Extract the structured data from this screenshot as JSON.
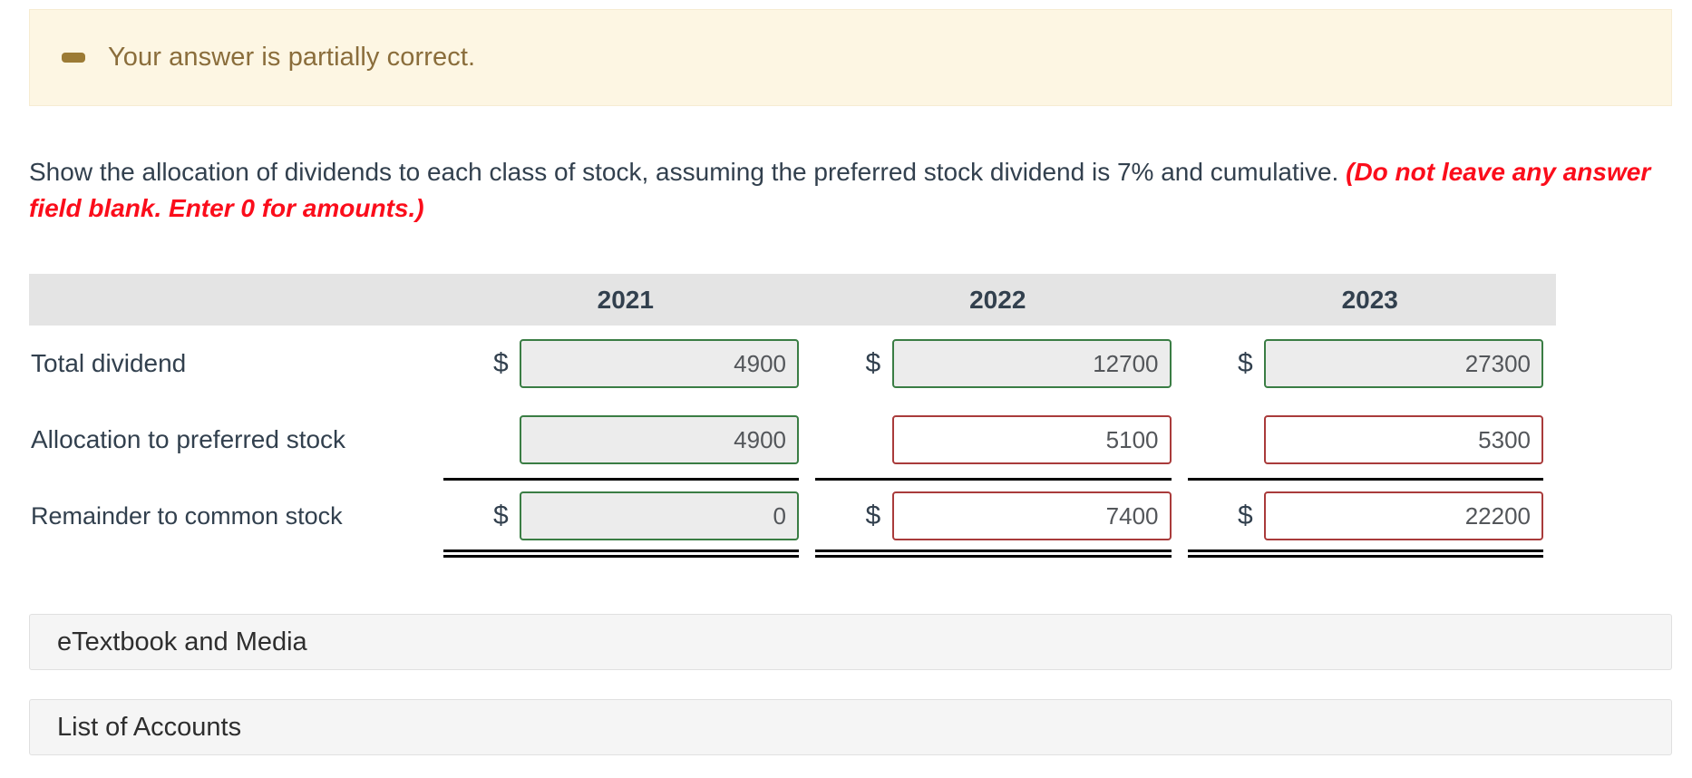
{
  "alert": {
    "icon": "minus-dash-icon",
    "message": "Your answer is partially correct.",
    "bg_color": "#fdf6e3",
    "text_color": "#8a6d3b"
  },
  "prompt": {
    "text_part1": "Show the allocation of dividends to each class of stock, assuming the preferred stock dividend is 7% and cumulative. ",
    "text_warning": "(Do not leave any answer field blank. Enter 0 for amounts.)",
    "warning_color": "#fb0d1b"
  },
  "table": {
    "columns": [
      "",
      "2021",
      "2022",
      "2023"
    ],
    "rows": [
      {
        "label": "Total dividend",
        "show_dollar": true,
        "cells": [
          {
            "value": "4900",
            "state": "ok",
            "dollar": "$"
          },
          {
            "value": "12700",
            "state": "ok",
            "dollar": "$"
          },
          {
            "value": "27300",
            "state": "ok",
            "dollar": "$"
          }
        ]
      },
      {
        "label": "Allocation to preferred stock",
        "show_dollar": false,
        "cells": [
          {
            "value": "4900",
            "state": "ok",
            "dollar": ""
          },
          {
            "value": "5100",
            "state": "bad",
            "dollar": ""
          },
          {
            "value": "5300",
            "state": "bad",
            "dollar": ""
          }
        ]
      },
      {
        "label": "Remainder to common stock",
        "show_dollar": true,
        "cells": [
          {
            "value": "0",
            "state": "ok",
            "dollar": "$"
          },
          {
            "value": "7400",
            "state": "bad",
            "dollar": "$"
          },
          {
            "value": "22200",
            "state": "bad",
            "dollar": "$"
          }
        ]
      }
    ],
    "header_bg": "#e4e4e4",
    "correct_border_color": "#3a7d44",
    "incorrect_border_color": "#a93b3b"
  },
  "panels": {
    "etextbook_label": "eTextbook and Media",
    "accounts_label": "List of Accounts"
  }
}
